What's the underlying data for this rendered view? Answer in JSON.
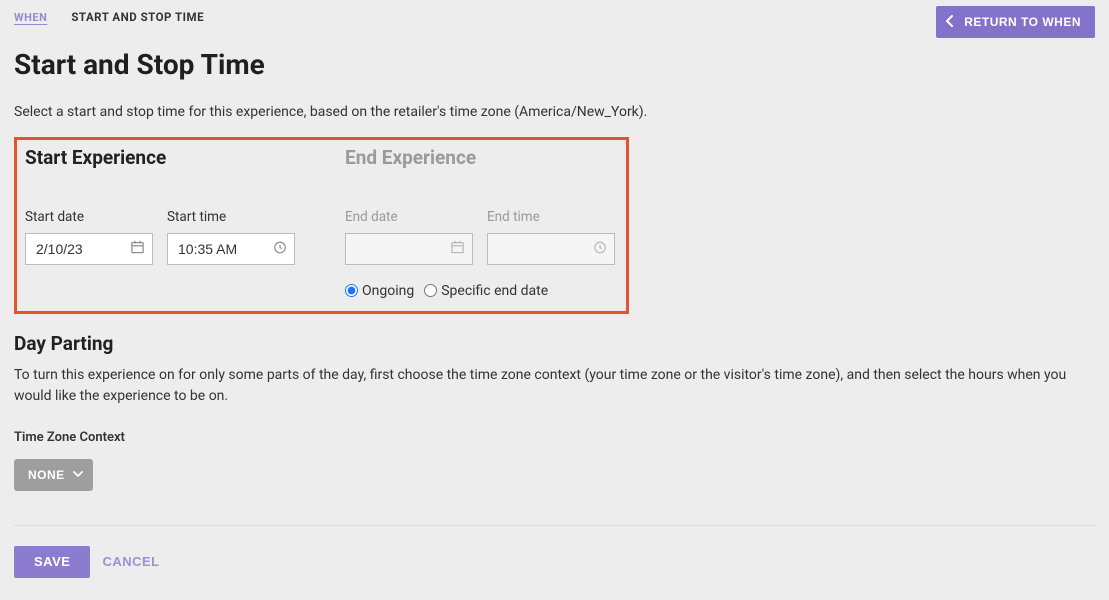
{
  "breadcrumbs": {
    "link": "WHEN",
    "current": "START AND STOP TIME"
  },
  "return_label": "RETURN TO WHEN",
  "title": "Start and Stop Time",
  "description": "Select a start and stop time for this experience, based on the retailer's time zone (America/New_York).",
  "start_section": {
    "heading": "Start Experience",
    "date_label": "Start date",
    "date_value": "2/10/23",
    "time_label": "Start time",
    "time_value": "10:35 AM"
  },
  "end_section": {
    "heading": "End Experience",
    "date_label": "End date",
    "time_label": "End time",
    "radio_ongoing": "Ongoing",
    "radio_specific": "Specific end date"
  },
  "day_parting": {
    "heading": "Day Parting",
    "desc": "To turn this experience on for only some parts of the day, first choose the time zone context (your time zone or the visitor's time zone), and then select the hours when you would like the experience to be on.",
    "tz_label": "Time Zone Context",
    "none_label": "NONE"
  },
  "actions": {
    "save": "SAVE",
    "cancel": "CANCEL"
  }
}
